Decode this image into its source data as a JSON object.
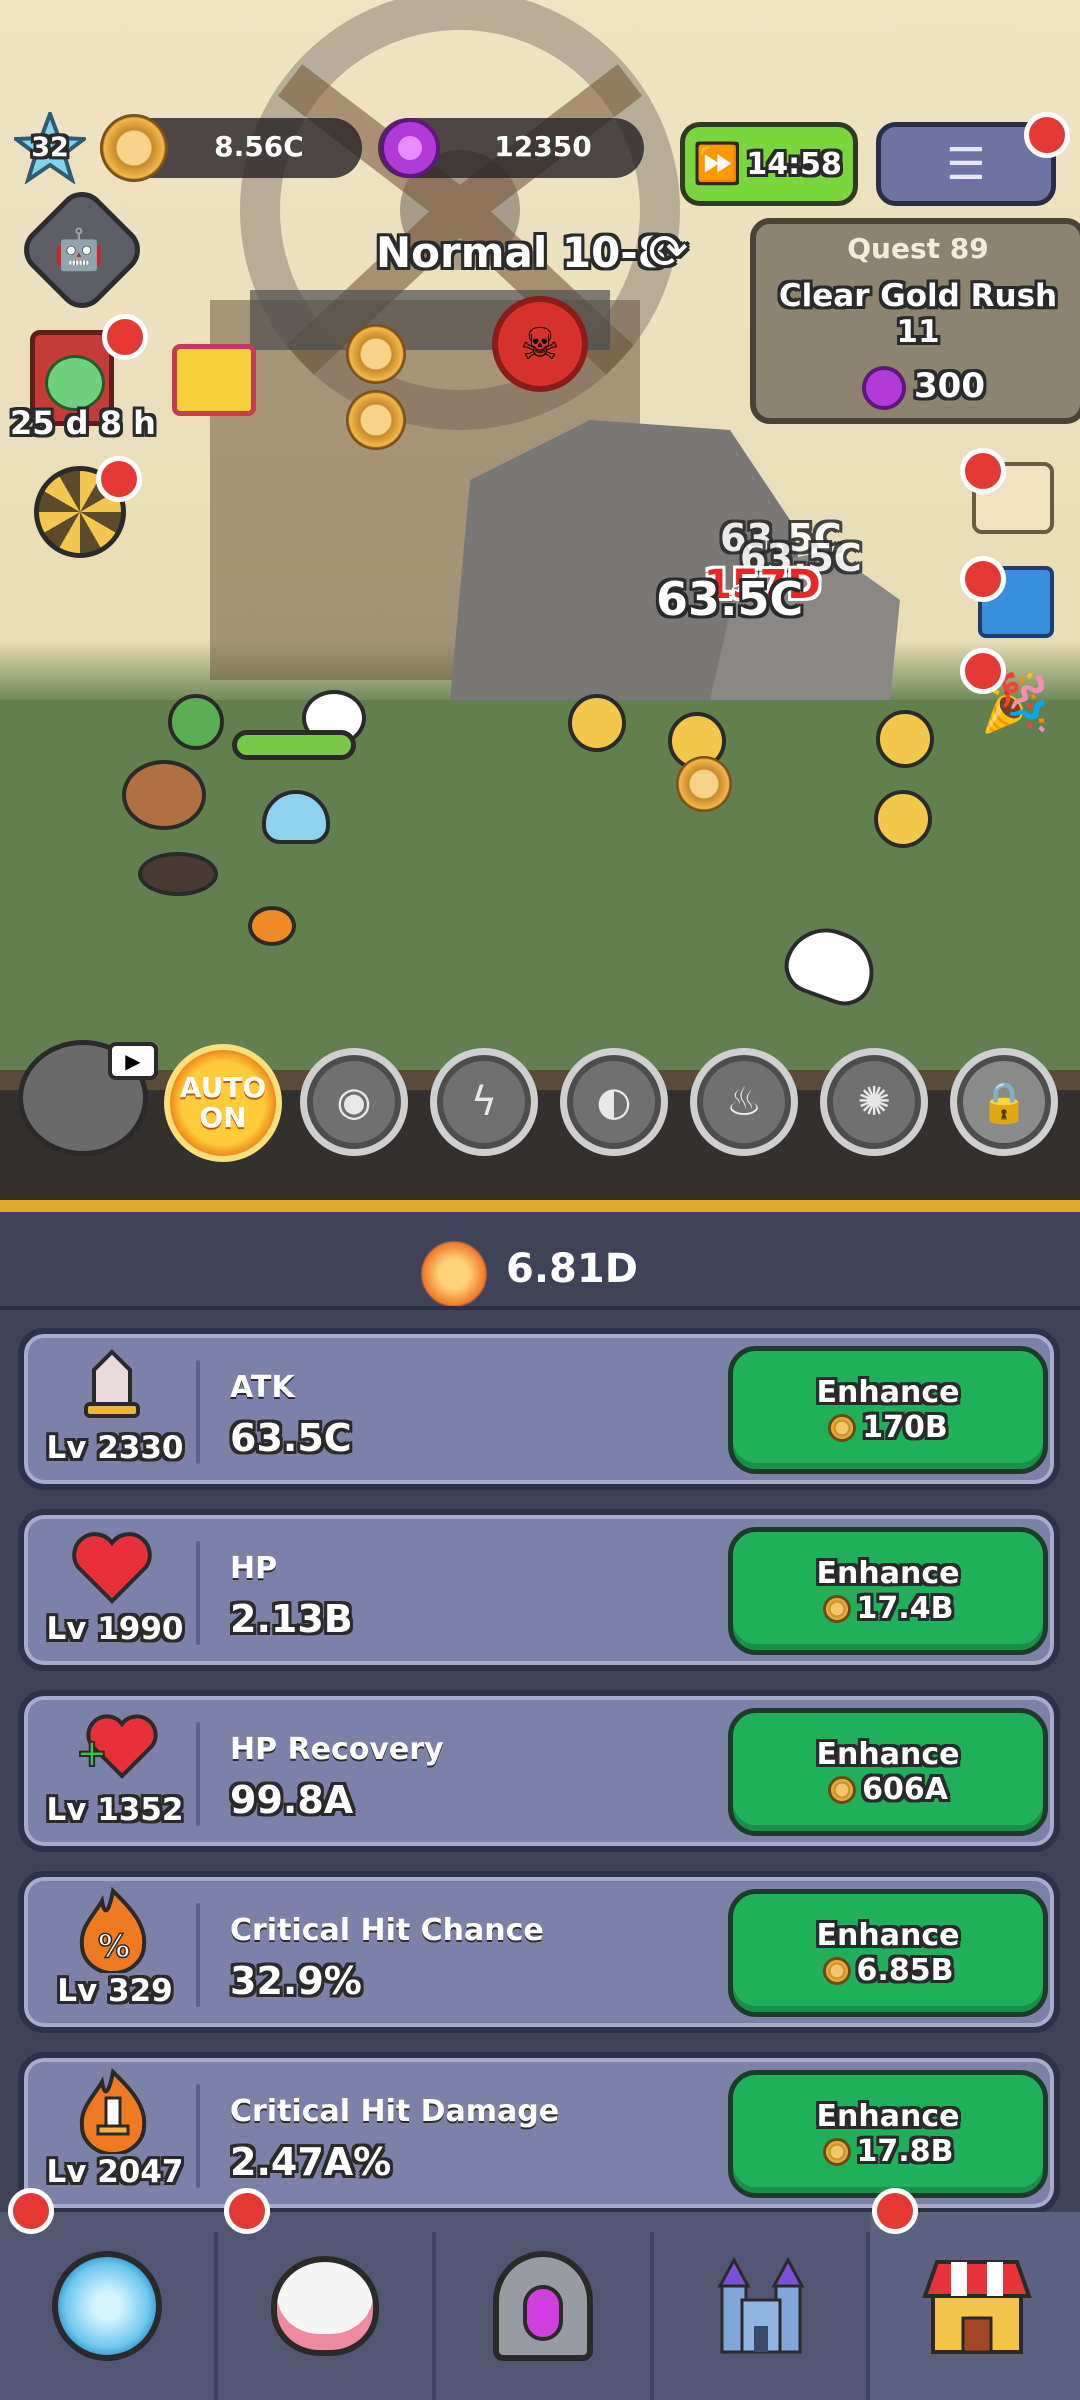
{
  "hud": {
    "player_level": "32",
    "gold": "8.56C",
    "gems": "12350",
    "speed_timer": "14:58",
    "stage": "Normal 10-8",
    "event_timer": "25 d 8 h"
  },
  "quest": {
    "title": "Quest 89",
    "description": "Clear Gold Rush 11",
    "reward": "300"
  },
  "battle": {
    "damage_popups": [
      "63.5C",
      "157D",
      "63.5C",
      "63.5C"
    ]
  },
  "skills": {
    "auto_label_1": "AUTO",
    "auto_label_2": "ON"
  },
  "power": {
    "total": "6.81D"
  },
  "stats": [
    {
      "name": "ATK",
      "level": "Lv 2330",
      "value": "63.5C",
      "button": "Enhance",
      "cost": "170B",
      "icon": "sword-icon"
    },
    {
      "name": "HP",
      "level": "Lv 1990",
      "value": "2.13B",
      "button": "Enhance",
      "cost": "17.4B",
      "icon": "heart-icon"
    },
    {
      "name": "HP Recovery",
      "level": "Lv 1352",
      "value": "99.8A",
      "button": "Enhance",
      "cost": "606A",
      "icon": "heart-plus-icon"
    },
    {
      "name": "Critical Hit Chance",
      "level": "Lv 329",
      "value": "32.9%",
      "button": "Enhance",
      "cost": "6.85B",
      "icon": "flame-percent-icon"
    },
    {
      "name": "Critical Hit Damage",
      "level": "Lv 2047",
      "value": "2.47A%",
      "button": "Enhance",
      "cost": "17.8B",
      "icon": "flame-sword-icon"
    }
  ],
  "nav": [
    {
      "icon": "slime-icon"
    },
    {
      "icon": "chicken-icon"
    },
    {
      "icon": "portal-icon"
    },
    {
      "icon": "castle-icon"
    },
    {
      "icon": "shop-icon"
    }
  ],
  "colors": {
    "enhance_green": "#21b05a",
    "card_bg": "#7d81a7",
    "panel_bg": "#3f4258",
    "alert_red": "#e53935",
    "gold_text": "#f2c14e"
  }
}
